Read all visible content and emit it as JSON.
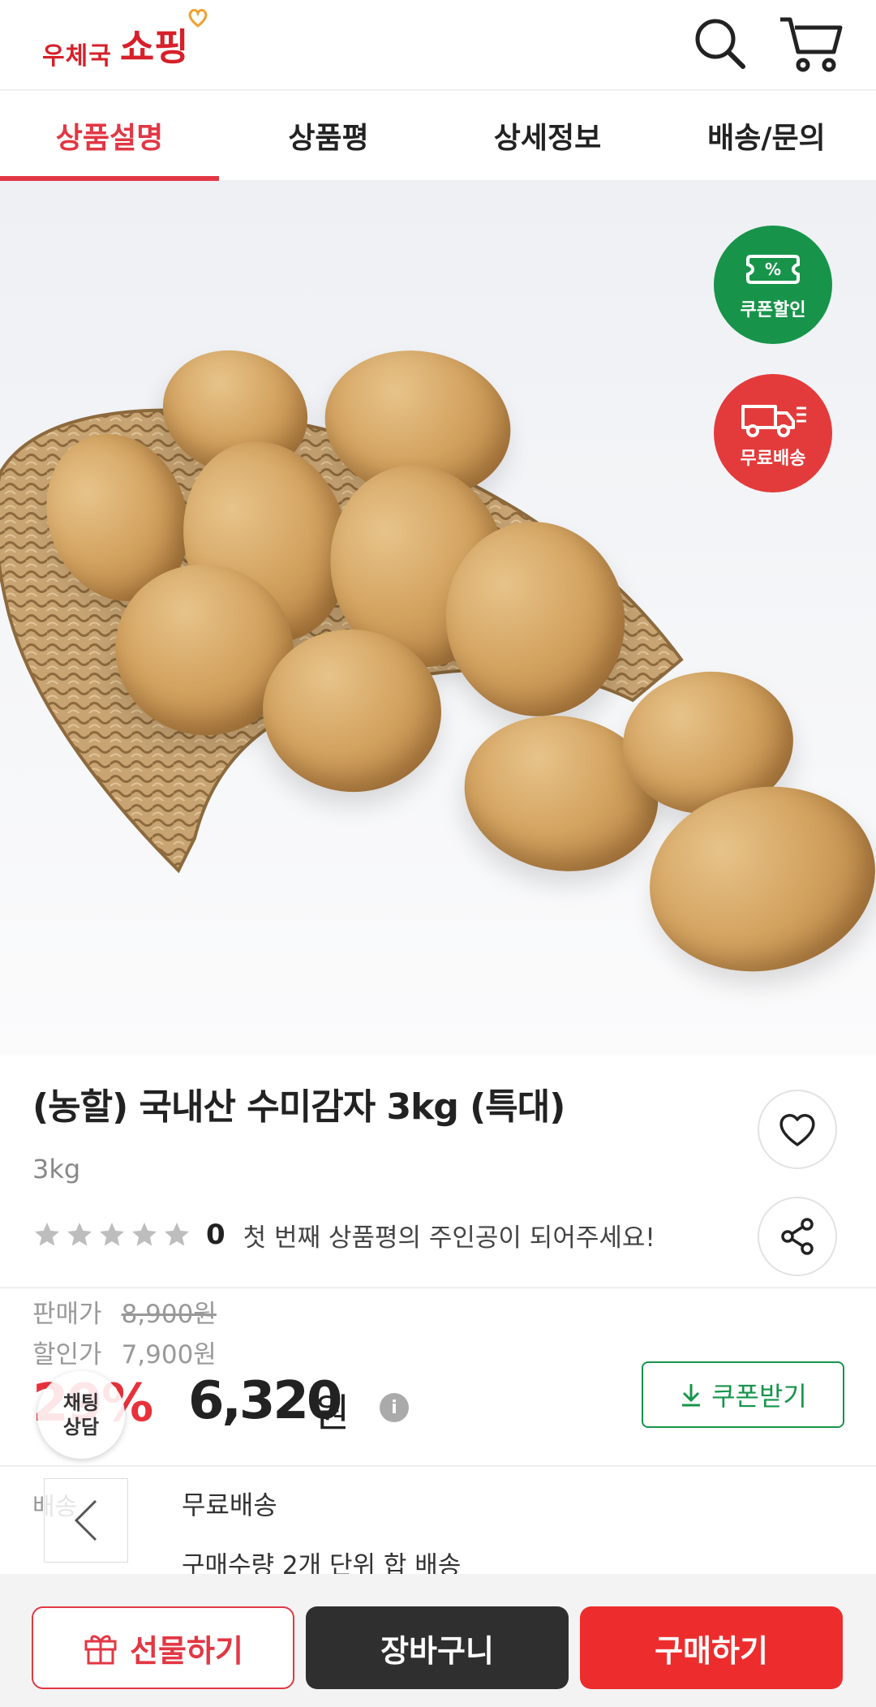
{
  "header": {
    "logo_small": "우체국",
    "logo_big": "쇼핑",
    "search_icon": "search-icon",
    "cart_icon": "cart-icon"
  },
  "tabs": [
    {
      "label": "상품설명",
      "active": true
    },
    {
      "label": "상품평",
      "active": false
    },
    {
      "label": "상세정보",
      "active": false
    },
    {
      "label": "배송/문의",
      "active": false
    }
  ],
  "badges": {
    "coupon": {
      "icon_text": "%",
      "label": "쿠폰할인",
      "color": "#17944a"
    },
    "free_shipping": {
      "label": "무료배송",
      "color": "#e33b3b"
    }
  },
  "product": {
    "title": "(농할) 국내산 수미감자 3kg (특대)",
    "option": "3kg",
    "rating_count": "0",
    "rating_text": "첫 번째 상품평의 주인공이 되어주세요!",
    "stars_filled": 0,
    "stars_total": 5
  },
  "price": {
    "original_label": "판매가",
    "original_value": "8,900원",
    "discount_label": "할인가",
    "discount_value": "7,900원",
    "rate": "29%",
    "final_number": "6,320",
    "final_unit": "원",
    "info_icon": "i",
    "coupon_button": "쿠폰받기"
  },
  "chat": {
    "line1": "채팅",
    "line2": "상담"
  },
  "shipping": {
    "label": "배송",
    "value": "무료배송",
    "note": "구매수량 2개 단위 합 배송"
  },
  "bottom_bar": {
    "gift": "선물하기",
    "cart": "장바구니",
    "buy": "구매하기"
  },
  "colors": {
    "accent_red": "#e23744",
    "coupon_green": "#17944a",
    "buy_red": "#ed2d2d",
    "cart_dark": "#2f2f2f"
  }
}
